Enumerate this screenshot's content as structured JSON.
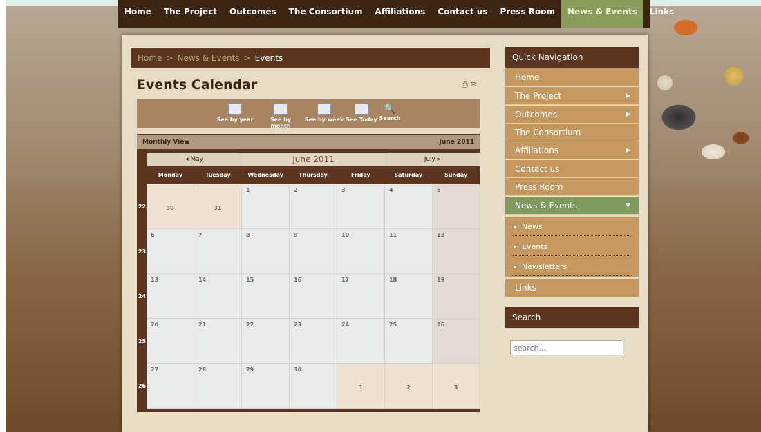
{
  "topnav": [
    "Home",
    "The Project",
    "Outcomes",
    "The Consortium",
    "Affiliations",
    "Contact us",
    "Press Room",
    "News & Events",
    "Links"
  ],
  "breadcrumb": {
    "home": "Home",
    "section": "News & Events",
    "current": "Events"
  },
  "page_title": "Events Calendar",
  "toolbar": {
    "year": "See by year",
    "month": "See by month",
    "week": "See by week",
    "today": "See Today",
    "search": "Search"
  },
  "calendar": {
    "view_label": "Monthly View",
    "month_label": "June 2011",
    "prev": "◂ May",
    "current": "June 2011",
    "next": "July ▸",
    "days": [
      "Monday",
      "Tuesday",
      "Wednesday",
      "Thursday",
      "Friday",
      "Saturday",
      "Sunday"
    ],
    "weeks": [
      {
        "no": "22",
        "days": [
          "30",
          "31",
          "1",
          "2",
          "3",
          "4",
          "5"
        ]
      },
      {
        "no": "23",
        "days": [
          "6",
          "7",
          "8",
          "9",
          "10",
          "11",
          "12"
        ]
      },
      {
        "no": "24",
        "days": [
          "13",
          "14",
          "15",
          "16",
          "17",
          "18",
          "19"
        ]
      },
      {
        "no": "25",
        "days": [
          "20",
          "21",
          "22",
          "23",
          "24",
          "25",
          "26"
        ]
      },
      {
        "no": "26",
        "days": [
          "27",
          "28",
          "29",
          "30",
          "1",
          "2",
          "3"
        ]
      }
    ]
  },
  "quick_nav": {
    "title": "Quick Navigation",
    "items": [
      "Home",
      "The Project",
      "Outcomes",
      "The Consortium",
      "Affiliations",
      "Contact us",
      "Press Room",
      "News & Events"
    ],
    "sub": [
      "News",
      "Events",
      "Newsletters"
    ],
    "links": "Links"
  },
  "search": {
    "title": "Search",
    "placeholder": "search..."
  }
}
